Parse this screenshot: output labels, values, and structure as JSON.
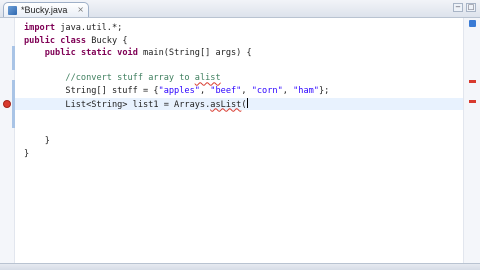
{
  "tab": {
    "label": "*Bucky.java",
    "close": "×"
  },
  "window_controls": [
    "−",
    "□"
  ],
  "code_lines": [
    {
      "segments": [
        {
          "t": "import",
          "c": "kw"
        },
        {
          "t": " java.util.*;",
          "c": ""
        }
      ]
    },
    {
      "segments": [
        {
          "t": "public",
          "c": "kw"
        },
        {
          "t": " ",
          "c": ""
        },
        {
          "t": "class",
          "c": "kw"
        },
        {
          "t": " Bucky {",
          "c": ""
        }
      ]
    },
    {
      "segments": [
        {
          "t": "    ",
          "c": ""
        },
        {
          "t": "public",
          "c": "kw"
        },
        {
          "t": " ",
          "c": ""
        },
        {
          "t": "static",
          "c": "kw"
        },
        {
          "t": " ",
          "c": ""
        },
        {
          "t": "void",
          "c": "kw"
        },
        {
          "t": " main(String[] args) {",
          "c": ""
        }
      ]
    },
    {
      "segments": []
    },
    {
      "segments": [
        {
          "t": "        ",
          "c": ""
        },
        {
          "t": "//convert stuff array to ",
          "c": "cmt"
        },
        {
          "t": "alist",
          "c": "cmt err"
        }
      ]
    },
    {
      "segments": [
        {
          "t": "        String[] stuff = {",
          "c": ""
        },
        {
          "t": "\"apples\"",
          "c": "str"
        },
        {
          "t": ", ",
          "c": ""
        },
        {
          "t": "\"beef\"",
          "c": "str"
        },
        {
          "t": ", ",
          "c": ""
        },
        {
          "t": "\"corn\"",
          "c": "str"
        },
        {
          "t": ", ",
          "c": ""
        },
        {
          "t": "\"ham\"",
          "c": "str"
        },
        {
          "t": "};",
          "c": ""
        }
      ]
    },
    {
      "segments": [
        {
          "t": "        List<String> list1 = Arrays.",
          "c": ""
        },
        {
          "t": "asList",
          "c": "err"
        },
        {
          "t": "(",
          "c": ""
        }
      ],
      "caret": true
    },
    {
      "segments": []
    },
    {
      "segments": []
    },
    {
      "segments": [
        {
          "t": "    }",
          "c": ""
        }
      ]
    },
    {
      "segments": [
        {
          "t": "}",
          "c": ""
        }
      ]
    }
  ]
}
